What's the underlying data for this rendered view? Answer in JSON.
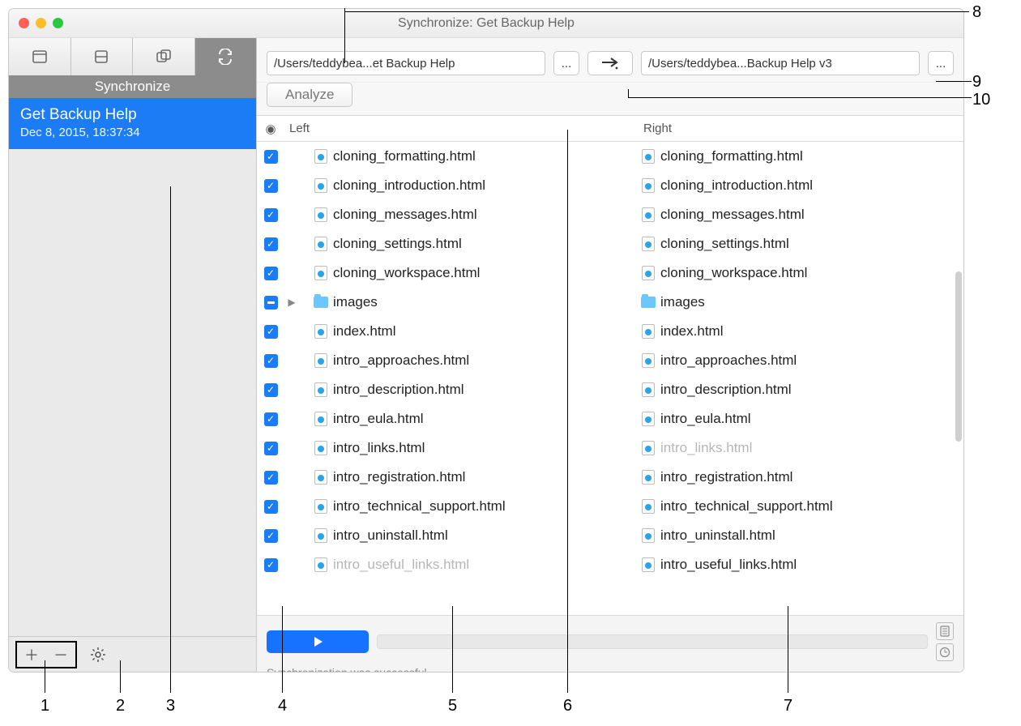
{
  "window": {
    "title": "Synchronize: Get Backup Help"
  },
  "sidebar": {
    "section_label": "Synchronize",
    "project": {
      "name": "Get Backup Help",
      "date": "Dec 8, 2015, 18:37:34"
    }
  },
  "toolbar": {
    "left_path": "/Users/teddybea...et Backup Help",
    "right_path": "/Users/teddybea...Backup Help v3",
    "analyze_label": "Analyze"
  },
  "headers": {
    "left": "Left",
    "right": "Right"
  },
  "rows": [
    {
      "checked": true,
      "type": "file",
      "left": "cloning_formatting.html",
      "right": "cloning_formatting.html"
    },
    {
      "checked": true,
      "type": "file",
      "left": "cloning_introduction.html",
      "right": "cloning_introduction.html"
    },
    {
      "checked": true,
      "type": "file",
      "left": "cloning_messages.html",
      "right": "cloning_messages.html"
    },
    {
      "checked": true,
      "type": "file",
      "left": "cloning_settings.html",
      "right": "cloning_settings.html"
    },
    {
      "checked": true,
      "type": "file",
      "left": "cloning_workspace.html",
      "right": "cloning_workspace.html"
    },
    {
      "checked": "indet",
      "type": "folder",
      "left": "images",
      "right": "images",
      "left_disclose": true
    },
    {
      "checked": true,
      "type": "file",
      "left": "index.html",
      "right": "index.html"
    },
    {
      "checked": true,
      "type": "file",
      "left": "intro_approaches.html",
      "right": "intro_approaches.html"
    },
    {
      "checked": true,
      "type": "file",
      "left": "intro_description.html",
      "right": "intro_description.html"
    },
    {
      "checked": true,
      "type": "file",
      "left": "intro_eula.html",
      "right": "intro_eula.html"
    },
    {
      "checked": true,
      "type": "file",
      "left": "intro_links.html",
      "right": "intro_links.html",
      "right_dim": true
    },
    {
      "checked": true,
      "type": "file",
      "left": "intro_registration.html",
      "right": "intro_registration.html"
    },
    {
      "checked": true,
      "type": "file",
      "left": "intro_technical_support.html",
      "right": "intro_technical_support.html"
    },
    {
      "checked": true,
      "type": "file",
      "left": "intro_uninstall.html",
      "right": "intro_uninstall.html"
    },
    {
      "checked": true,
      "type": "file",
      "left": "intro_useful_links.html",
      "right": "intro_useful_links.html",
      "left_dim": true
    }
  ],
  "status": "Synchronization was successful.",
  "annotations": [
    "1",
    "2",
    "3",
    "4",
    "5",
    "6",
    "7",
    "8",
    "9",
    "10"
  ]
}
